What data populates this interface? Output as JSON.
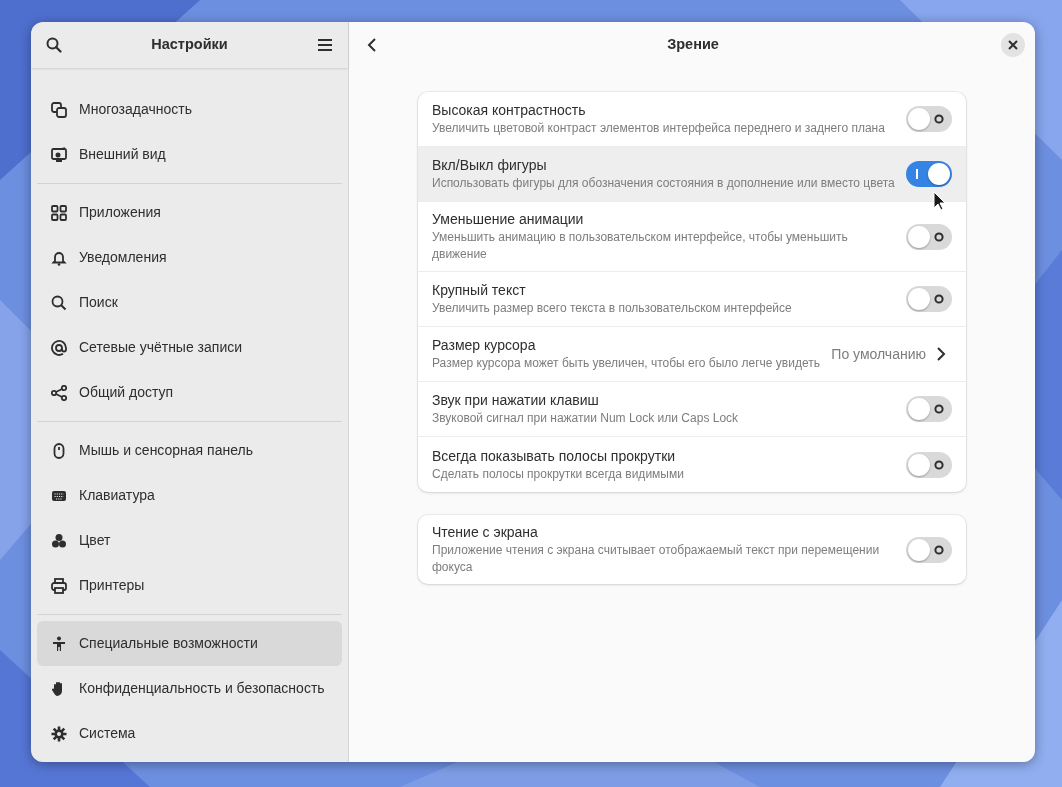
{
  "window": {
    "title": "Настройки"
  },
  "sidebar": {
    "groups": [
      {
        "items": [
          {
            "label": "Многозадачность",
            "selected": false
          },
          {
            "label": "Внешний вид",
            "selected": false
          }
        ]
      },
      {
        "items": [
          {
            "label": "Приложения",
            "selected": false
          },
          {
            "label": "Уведомления",
            "selected": false
          },
          {
            "label": "Поиск",
            "selected": false
          },
          {
            "label": "Сетевые учётные записи",
            "selected": false
          },
          {
            "label": "Общий доступ",
            "selected": false
          }
        ]
      },
      {
        "items": [
          {
            "label": "Мышь и сенсорная панель",
            "selected": false
          },
          {
            "label": "Клавиатура",
            "selected": false
          },
          {
            "label": "Цвет",
            "selected": false
          },
          {
            "label": "Принтеры",
            "selected": false
          }
        ]
      },
      {
        "items": [
          {
            "label": "Специальные возможности",
            "selected": true
          },
          {
            "label": "Конфиденциальность и безопасность",
            "selected": false
          },
          {
            "label": "Система",
            "selected": false
          }
        ]
      }
    ]
  },
  "page": {
    "title": "Зрение"
  },
  "groups": [
    {
      "rows": [
        {
          "kind": "switch",
          "title": "Высокая контрастность",
          "subtitle": "Увеличить цветовой контраст элементов интерфейса переднего и заднего плана",
          "on": false,
          "hovered": false
        },
        {
          "kind": "switch",
          "title": "Вкл/Выкл фигуры",
          "subtitle": "Использовать фигуры для обозначения состояния в дополнение или вместо цвета",
          "on": true,
          "hovered": true
        },
        {
          "kind": "switch",
          "title": "Уменьшение анимации",
          "subtitle": "Уменьшить анимацию в пользовательском интерфейсе, чтобы уменьшить движение",
          "on": false,
          "hovered": false
        },
        {
          "kind": "switch",
          "title": "Крупный текст",
          "subtitle": "Увеличить размер всего текста в пользовательском интерфейсе",
          "on": false,
          "hovered": false
        },
        {
          "kind": "link",
          "title": "Размер курсора",
          "subtitle": "Размер курсора может быть увеличен, чтобы его было легче увидеть",
          "value": "По умолчанию",
          "hovered": false
        },
        {
          "kind": "switch",
          "title": "Звук при нажатии клавиш",
          "subtitle": "Звуковой сигнал при нажатии Num Lock или Caps Lock",
          "on": false,
          "hovered": false
        },
        {
          "kind": "switch",
          "title": "Всегда показывать полосы прокрутки",
          "subtitle": "Сделать полосы прокрутки всегда видимыми",
          "on": false,
          "hovered": false
        }
      ]
    },
    {
      "rows": [
        {
          "kind": "switch",
          "title": "Чтение с экрана",
          "subtitle": "Приложение чтения с экрана считывает отображаемый текст при перемещении фокуса",
          "on": false,
          "hovered": false
        }
      ]
    }
  ]
}
